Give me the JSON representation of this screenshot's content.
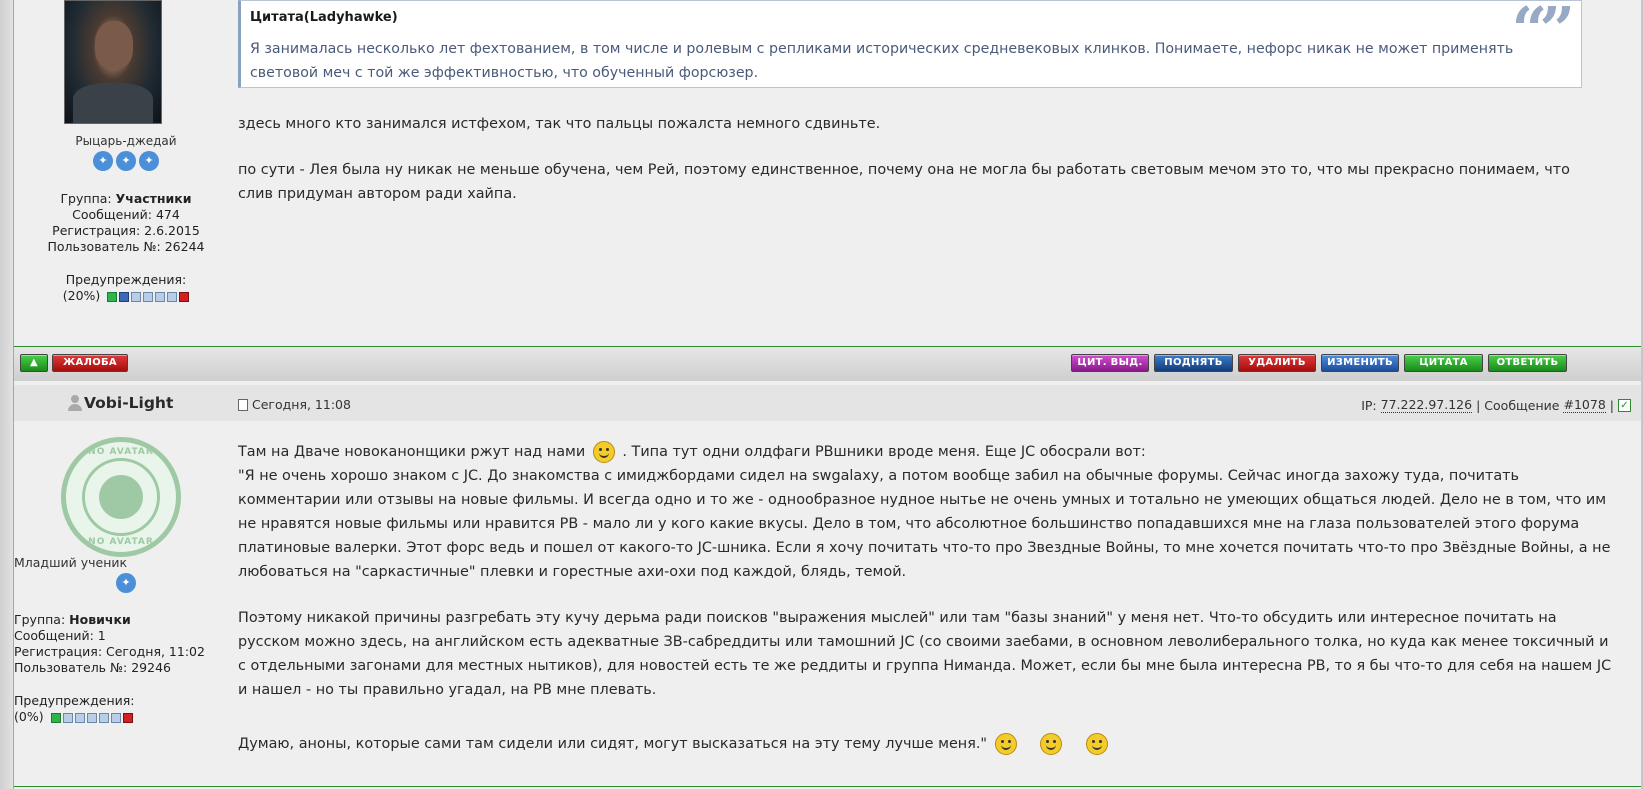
{
  "post1": {
    "user": {
      "rank": "Рыцарь-джедай",
      "group_label": "Группа:",
      "group_value": "Участники",
      "posts": "Сообщений: 474",
      "registered": "Регистрация: 2.6.2015",
      "user_no": "Пользователь №: 26244",
      "warnings_label": "Предупреждения:",
      "warnings_value": "(20%)"
    },
    "quote": {
      "header": "Цитата(Ladyhawke)",
      "text": "Я занималась несколько лет фехтованием, в том числе и ролевым с репликами исторических средневековых клинков. Понимаете, нефорс никак не может применять световой меч с той же эффективностью, что обученный форсюзер.",
      "mark": "“”"
    },
    "paragraphs": [
      "здесь много кто занимался истфехом, так что пальцы пожалста немного сдвиньте.",
      "по сути - Лея была ну никак не меньше обучена, чем Рей, поэтому единственное, почему она не могла бы работать световым мечом это то, что мы прекрасно понимаем, что слив придуман автором ради хайпа."
    ]
  },
  "buttons": {
    "up": "▲",
    "complaint": "ЖАЛОБА",
    "quote_selected": "ЦИТ. ВЫД.",
    "raise": "ПОДНЯТЬ",
    "delete": "УДАЛИТЬ",
    "edit": "ИЗМЕНИТЬ",
    "quote": "ЦИТАТА",
    "reply": "ОТВЕТИТЬ"
  },
  "post2": {
    "username": "Vobi-Light",
    "date": "Сегодня, 11:08",
    "ip_label": "IP:",
    "ip": "77.222.97.126",
    "sep": "|",
    "msg_label": "Сообщение",
    "msg_no": "#1078",
    "avatar_text": "NO AVATAR",
    "user": {
      "rank": "Младший ученик",
      "group_label": "Группа:",
      "group_value": "Новички",
      "posts": "Сообщений: 1",
      "registered": "Регистрация: Сегодня, 11:02",
      "user_no": "Пользователь №: 29246",
      "warnings_label": "Предупреждения:",
      "warnings_value": "(0%)"
    },
    "line1_a": "Там на Дваче новоканонщики ржут над нами",
    "line1_b": ". Типа тут одни олдфаги РВшники вроде меня. Еще JC обосрали вот:",
    "quote_para": "\"Я не очень хорошо знаком с JC. До знакомства с имиджбордами сидел на swgalaxy, а потом вообще забил на обычные форумы. Сейчас иногда захожу туда, почитать комментарии или отзывы на новые фильмы. И всегда одно и то же - однообразное нудное нытье не очень умных и тотально не умеющих общаться людей. Дело не в том, что им не нравятся новые фильмы или нравится РВ - мало ли у кого какие вкусы. Дело в том, что абсолютное большинство попадавшихся мне на глаза пользователей этого форума платиновые валерки. Этот форс ведь и пошел от какого-то JC-шника. Если я хочу почитать что-то про Звездные Войны, то мне хочется почитать что-то про Звёздные Войны, а не любоваться на \"саркастичные\" плевки и горестные ахи-охи под каждой, блядь, темой.",
    "para2": "Поэтому никакой причины разгребать эту кучу дерьма ради поисков \"выражения мыслей\" или там \"базы знаний\" у меня нет. Что-то обсудить или интересное почитать на русском можно здесь, на английском есть адекватные ЗВ-сабреддиты или тамошний JC (со своими заебами, в основном леволиберального толка, но куда как менее токсичный и с отдельными загонами для местных нытиков), для новостей есть те же реддиты и группа Ниманда. Может, если бы мне была интересна РВ, то я бы что-то для себя на нашем JC и нашел - но ты правильно угадал, на РВ мне плевать.",
    "para3": "Думаю, аноны, которые сами там сидели или сидят, могут высказаться на эту тему лучше меня.\""
  },
  "icons": {
    "rebel": "rebel-alliance-icon",
    "smile": "smile-icon"
  },
  "colors": {
    "green_line": "#2d8a2d",
    "quote_text": "#4a5a7a"
  }
}
